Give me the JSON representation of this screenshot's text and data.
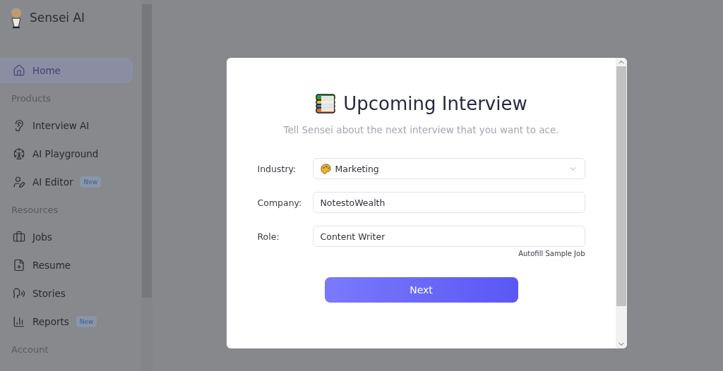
{
  "brand": {
    "name": "Sensei AI"
  },
  "sidebar": {
    "items": [
      {
        "kind": "item",
        "label": "Home",
        "selected": true
      },
      {
        "kind": "section",
        "label": "Products"
      },
      {
        "kind": "item",
        "label": "Interview AI",
        "selected": false
      },
      {
        "kind": "item",
        "label": "AI Playground",
        "selected": false
      },
      {
        "kind": "item",
        "label": "AI Editor",
        "selected": false,
        "badge": "New"
      },
      {
        "kind": "section",
        "label": "Resources"
      },
      {
        "kind": "item",
        "label": "Jobs",
        "selected": false
      },
      {
        "kind": "item",
        "label": "Resume",
        "selected": false
      },
      {
        "kind": "item",
        "label": "Stories",
        "selected": false
      },
      {
        "kind": "item",
        "label": "Reports",
        "selected": false,
        "badge": "New"
      },
      {
        "kind": "section",
        "label": "Account"
      }
    ]
  },
  "dialog": {
    "title": "Upcoming Interview",
    "subtitle": "Tell Sensei about the next interview that you want to ace.",
    "fields": [
      {
        "kind": "select",
        "label": "Industry:",
        "value": "Marketing"
      },
      {
        "kind": "input",
        "label": "Company:",
        "value": "NotestoWealth"
      },
      {
        "kind": "input",
        "label": "Role:",
        "value": "Content Writer"
      }
    ],
    "autofill_link": "Autofill Sample Job",
    "next_button": "Next"
  }
}
